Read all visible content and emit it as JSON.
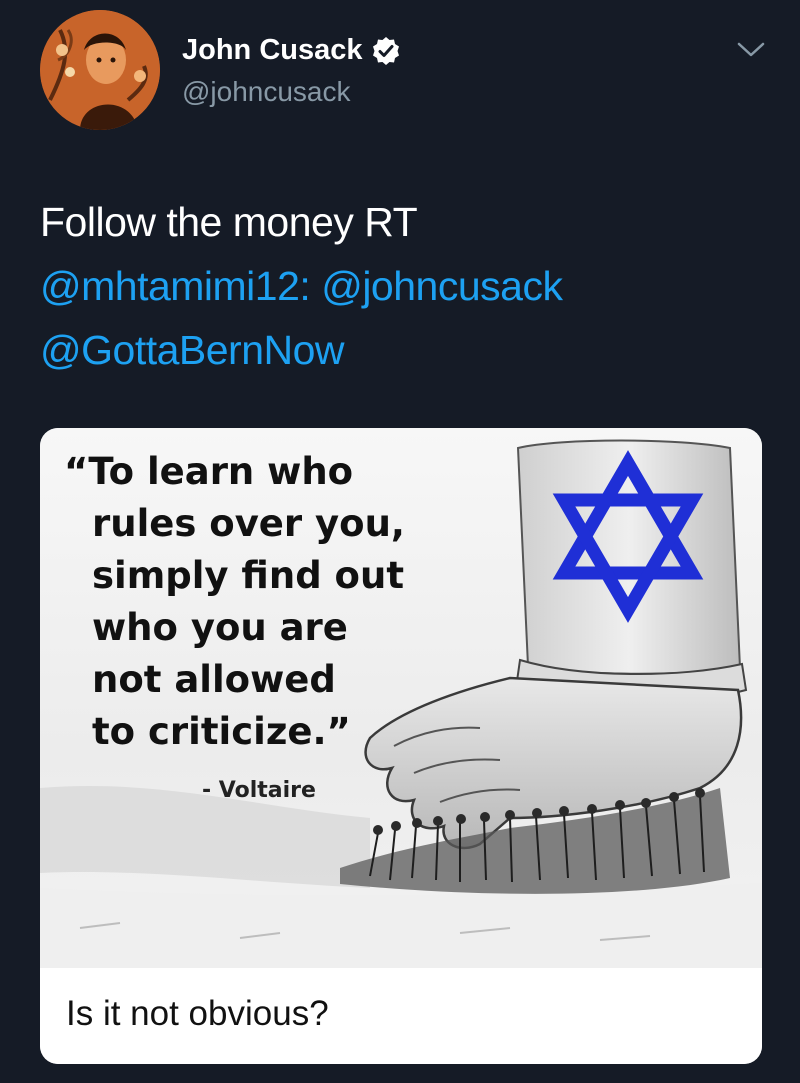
{
  "author": {
    "display_name": "John Cusack",
    "handle": "@johncusack",
    "verified_icon": "verified-badge-icon",
    "avatar_icon": "avatar-photo",
    "menu_icon": "chevron-down-icon"
  },
  "tweet": {
    "lines": [
      {
        "segments": [
          {
            "text": "Follow the money  RT",
            "type": "plain"
          }
        ]
      },
      {
        "segments": [
          {
            "text": "@mhtamimi12:",
            "type": "mention"
          },
          {
            "text": " ",
            "type": "plain"
          },
          {
            "text": "@johncusack",
            "type": "mention"
          }
        ]
      },
      {
        "segments": [
          {
            "text": "@GottaBernNow",
            "type": "mention"
          }
        ]
      }
    ]
  },
  "media": {
    "quote_lines": [
      "“To learn who",
      "rules over you,",
      "simply find out",
      "who you are",
      "not allowed",
      "to criticize.”"
    ],
    "attribution": "- Voltaire",
    "caption": "Is it not obvious?",
    "star_icon": "star-of-david-icon",
    "illustration": "hand-pressing-down-on-people-illustration"
  },
  "colors": {
    "background": "#151b26",
    "text": "#ffffff",
    "secondary": "#8899a6",
    "link": "#1da1f2",
    "star": "#1f2fd6"
  }
}
